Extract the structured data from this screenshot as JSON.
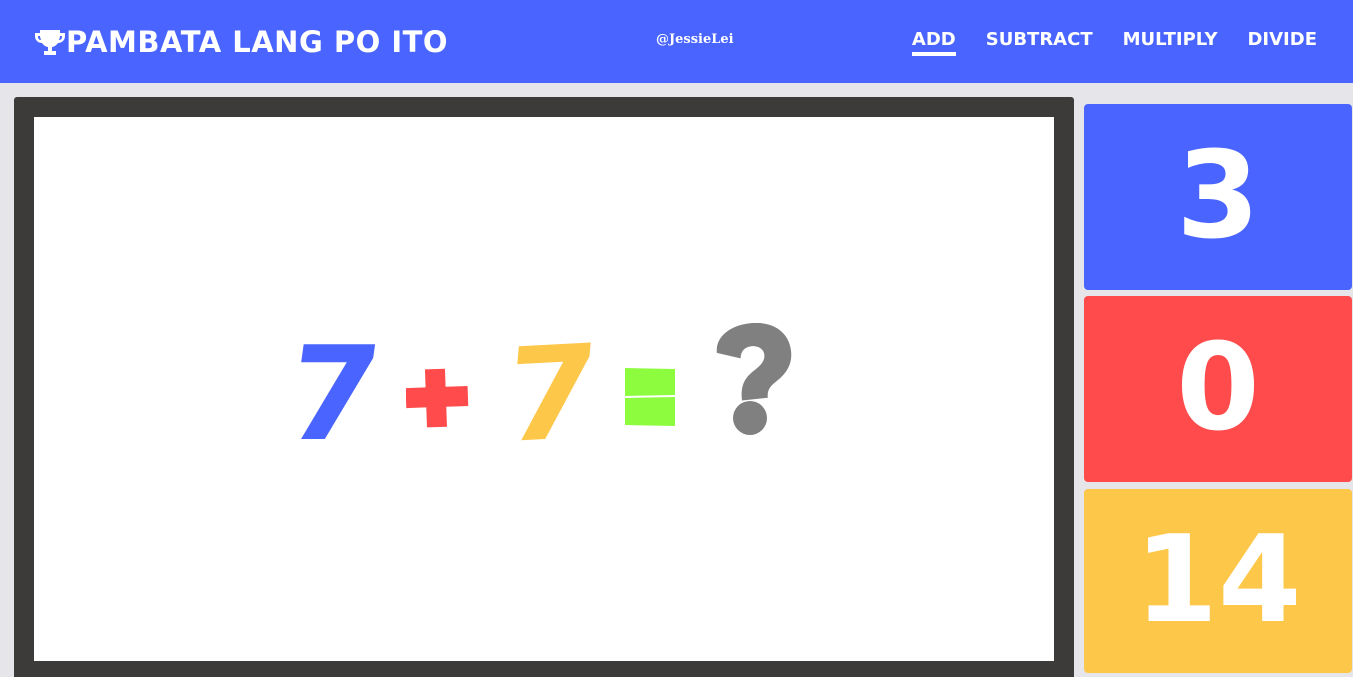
{
  "header": {
    "title": "PAMBATA LANG PO ITO",
    "author": "@JessieLei",
    "nav": [
      {
        "label": "ADD",
        "active": true
      },
      {
        "label": "SUBTRACT",
        "active": false
      },
      {
        "label": "MULTIPLY",
        "active": false
      },
      {
        "label": "DIVIDE",
        "active": false
      }
    ]
  },
  "equation": {
    "left": "7",
    "operator": "plus",
    "right": "7",
    "equals": "equals",
    "unknown": "?"
  },
  "answers": [
    {
      "value": "3",
      "color": "#4a65ff"
    },
    {
      "value": "0",
      "color": "#ff4b4b"
    },
    {
      "value": "14",
      "color": "#fdc74a"
    }
  ],
  "colors": {
    "header": "#4a65ff",
    "board_frame": "#3d3b3a",
    "operator": "#ff4b4b",
    "equals": "#8dfc3e",
    "unknown": "#808080"
  },
  "icons": {
    "brand": "trophy-icon"
  }
}
